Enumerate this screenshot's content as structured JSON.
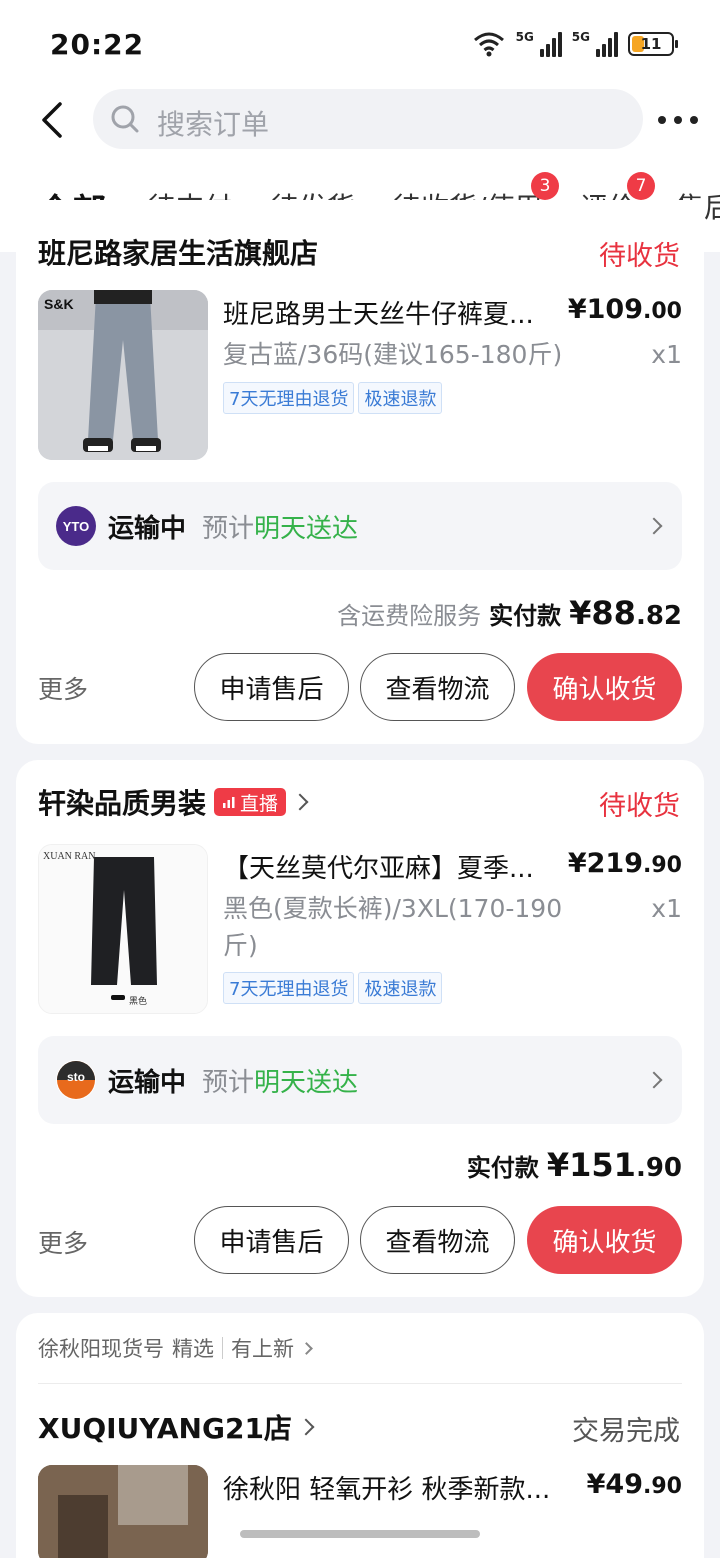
{
  "status_bar": {
    "time": "20:22",
    "battery": "11",
    "net1": "5G",
    "net2": "5G"
  },
  "header": {
    "search_placeholder": "搜索订单"
  },
  "tabs": [
    {
      "label": "全部",
      "active": true
    },
    {
      "label": "待支付"
    },
    {
      "label": "待发货"
    },
    {
      "label": "待收货/使用",
      "badge": "3"
    },
    {
      "label": "评价",
      "badge": "7"
    },
    {
      "label": "售后"
    }
  ],
  "orders": [
    {
      "shop": "班尼路家居生活旗舰店",
      "status": "待收货",
      "product": {
        "title": "班尼路男士天丝牛仔裤夏...",
        "spec": "复古蓝/36码(建议165-180斤)",
        "price_int": "¥109",
        "price_dec": ".00",
        "qty": "x1",
        "image_brand": "S&K",
        "tags": [
          "7天无理由退货",
          "极速退款"
        ]
      },
      "logistics": {
        "status": "运输中",
        "eta_prefix": "预计",
        "eta_highlight": "明天送达",
        "carrier_logo": "YTO"
      },
      "payment": {
        "note": "含运费险服务",
        "label": "实付款",
        "amount_int": "¥88",
        "amount_dec": ".82"
      },
      "actions": {
        "more": "更多",
        "after_sale": "申请售后",
        "track": "查看物流",
        "confirm": "确认收货"
      }
    },
    {
      "shop": "轩染品质男装",
      "live": "直播",
      "status": "待收货",
      "product": {
        "title": "【天丝莫代尔亚麻】夏季...",
        "spec": "黑色(夏款长裤)/3XL(170-190斤)",
        "price_int": "¥219",
        "price_dec": ".90",
        "qty": "x1",
        "image_brand": "XUAN RAN",
        "image_caption": "黑色",
        "tags": [
          "7天无理由退货",
          "极速退款"
        ]
      },
      "logistics": {
        "status": "运输中",
        "eta_prefix": "预计",
        "eta_highlight": "明天送达",
        "carrier_logo": "sto"
      },
      "payment": {
        "label": "实付款",
        "amount_int": "¥151",
        "amount_dec": ".90"
      },
      "actions": {
        "more": "更多",
        "after_sale": "申请售后",
        "track": "查看物流",
        "confirm": "确认收货"
      }
    },
    {
      "promo_source": "徐秋阳现货号",
      "promo_pick": "精选",
      "promo_new": "有上新",
      "shop": "XUQIUYANG21店",
      "status": "交易完成",
      "product": {
        "title": "徐秋阳   轻氧开衫 秋季新款...",
        "price_int": "¥49",
        "price_dec": ".90"
      }
    }
  ],
  "colors": {
    "accent": "#e8454e",
    "status_red": "#e8323f",
    "green": "#35b24a",
    "tag_blue": "#3a7bd5"
  }
}
